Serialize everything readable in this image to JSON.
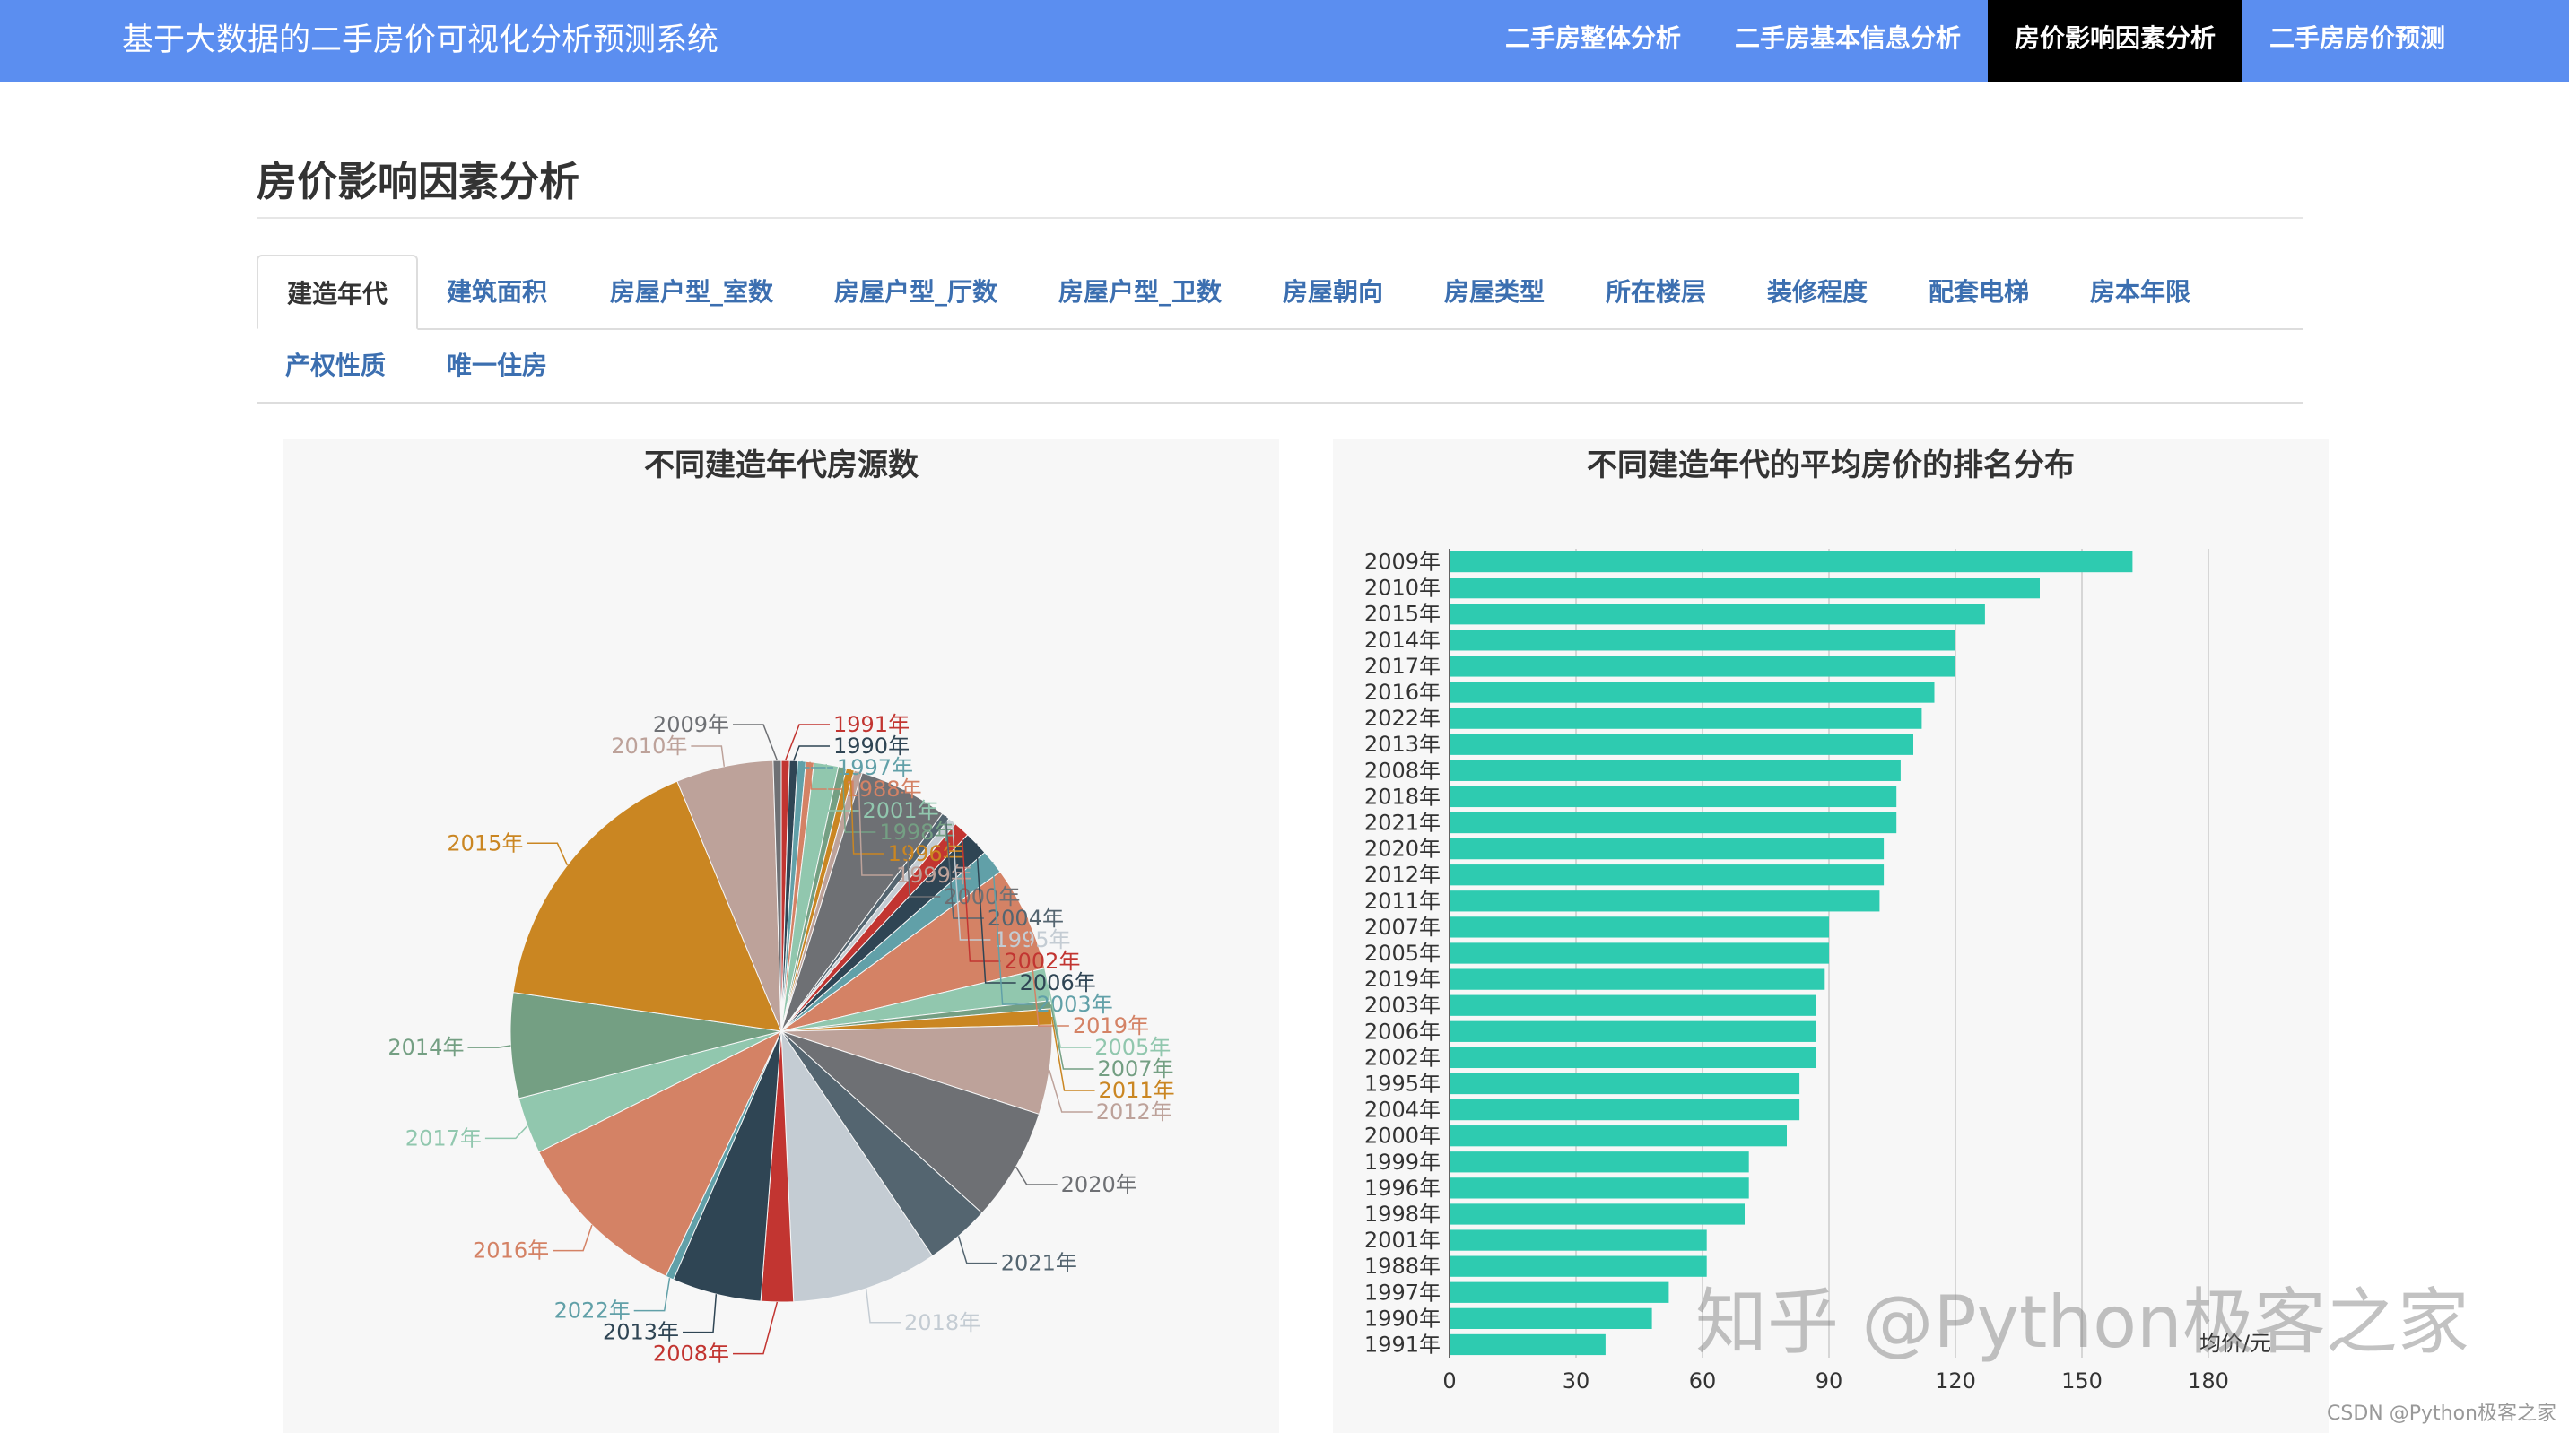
{
  "app": {
    "title": "基于大数据的二手房价可视化分析预测系统",
    "nav": [
      {
        "label": "二手房整体分析",
        "active": false
      },
      {
        "label": "二手房基本信息分析",
        "active": false
      },
      {
        "label": "房价影响因素分析",
        "active": true
      },
      {
        "label": "二手房房价预测",
        "active": false
      }
    ]
  },
  "page": {
    "title": "房价影响因素分析",
    "tabs_row1": [
      "建造年代",
      "建筑面积",
      "房屋户型_室数",
      "房屋户型_厅数",
      "房屋户型_卫数",
      "房屋朝向",
      "房屋类型",
      "所在楼层",
      "装修程度",
      "配套电梯",
      "房本年限"
    ],
    "tabs_row2": [
      "产权性质",
      "唯一住房"
    ],
    "active_tab": "建造年代"
  },
  "chart_data": [
    {
      "type": "pie",
      "title": "不同建造年代房源数",
      "slices": [
        {
          "label": "1991年",
          "value": 1,
          "color": "#c23531"
        },
        {
          "label": "1990年",
          "value": 1,
          "color": "#2f4554"
        },
        {
          "label": "1997年",
          "value": 1,
          "color": "#61a0a8"
        },
        {
          "label": "1988年",
          "value": 1,
          "color": "#d48265"
        },
        {
          "label": "2001年",
          "value": 3,
          "color": "#91c7ae"
        },
        {
          "label": "1998年",
          "value": 1,
          "color": "#749f83"
        },
        {
          "label": "1996年",
          "value": 1,
          "color": "#ca8622"
        },
        {
          "label": "1999年",
          "value": 1,
          "color": "#bda29a"
        },
        {
          "label": "2000年",
          "value": 11,
          "color": "#6e7074"
        },
        {
          "label": "2004年",
          "value": 1,
          "color": "#546570"
        },
        {
          "label": "1995年",
          "value": 1,
          "color": "#c4ccd3"
        },
        {
          "label": "2002年",
          "value": 2,
          "color": "#c23531"
        },
        {
          "label": "2006年",
          "value": 3,
          "color": "#2f4554"
        },
        {
          "label": "2003年",
          "value": 3,
          "color": "#61a0a8"
        },
        {
          "label": "2019年",
          "value": 13,
          "color": "#d48265"
        },
        {
          "label": "2005年",
          "value": 4,
          "color": "#91c7ae"
        },
        {
          "label": "2007年",
          "value": 1,
          "color": "#749f83"
        },
        {
          "label": "2011年",
          "value": 2,
          "color": "#ca8622"
        },
        {
          "label": "2012年",
          "value": 11,
          "color": "#bda29a"
        },
        {
          "label": "2020年",
          "value": 14,
          "color": "#6e7074"
        },
        {
          "label": "2021年",
          "value": 8,
          "color": "#546570"
        },
        {
          "label": "2018年",
          "value": 18,
          "color": "#c4ccd3"
        },
        {
          "label": "2008年",
          "value": 4,
          "color": "#c23531"
        },
        {
          "label": "2013年",
          "value": 11,
          "color": "#2f4554"
        },
        {
          "label": "2022年",
          "value": 1,
          "color": "#61a0a8"
        },
        {
          "label": "2016年",
          "value": 22,
          "color": "#d48265"
        },
        {
          "label": "2017年",
          "value": 7,
          "color": "#91c7ae"
        },
        {
          "label": "2014年",
          "value": 13,
          "color": "#749f83"
        },
        {
          "label": "2015年",
          "value": 34,
          "color": "#ca8622"
        },
        {
          "label": "2010年",
          "value": 12,
          "color": "#bda29a"
        },
        {
          "label": "2009年",
          "value": 1,
          "color": "#6e7074"
        }
      ]
    },
    {
      "type": "bar",
      "orientation": "horizontal",
      "title": "不同建造年代的平均房价的排名分布",
      "xlabel": "均价/元",
      "xlim": [
        0,
        180
      ],
      "xticks": [
        0,
        30,
        60,
        90,
        120,
        150,
        180
      ],
      "bar_color": "#2ecbb0",
      "grid": true,
      "categories": [
        "2009年",
        "2010年",
        "2015年",
        "2014年",
        "2017年",
        "2016年",
        "2022年",
        "2013年",
        "2008年",
        "2018年",
        "2021年",
        "2020年",
        "2012年",
        "2011年",
        "2007年",
        "2005年",
        "2019年",
        "2003年",
        "2006年",
        "2002年",
        "1995年",
        "2004年",
        "2000年",
        "1999年",
        "1996年",
        "1998年",
        "2001年",
        "1988年",
        "1997年",
        "1990年",
        "1991年"
      ],
      "values": [
        162,
        140,
        127,
        120,
        120,
        115,
        112,
        110,
        107,
        106,
        106,
        103,
        103,
        102,
        90,
        90,
        89,
        87,
        87,
        87,
        83,
        83,
        80,
        71,
        71,
        70,
        61,
        61,
        52,
        48,
        37
      ]
    }
  ],
  "watermark": "知乎 @Python极客之家",
  "credit": "CSDN @Python极客之家"
}
